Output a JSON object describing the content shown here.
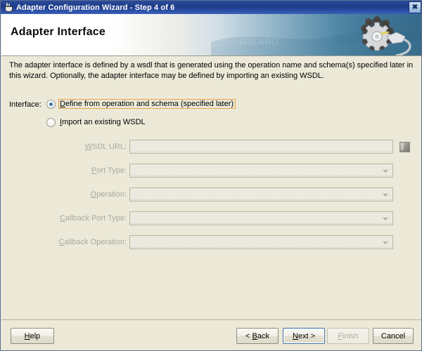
{
  "window": {
    "title": "Adapter Configuration Wizard - Step 4 of 6",
    "app_icon": "java-coffee-cup-icon",
    "close_label": "✕"
  },
  "header": {
    "title": "Adapter Interface",
    "banner_icon": "gear-and-cable-icon",
    "accent_color": "#376a8a"
  },
  "body": {
    "description": "The adapter interface is defined by a wsdl that is generated using the operation name and schema(s) specified later in this wizard.  Optionally, the adapter interface may be defined by importing an existing WSDL.",
    "interface_label": "Interface:",
    "options": [
      {
        "mnemonic": "D",
        "rest": "efine from operation and schema (specified later)",
        "selected": true,
        "focused": true
      },
      {
        "mnemonic": "I",
        "rest": "mport an existing WSDL",
        "selected": false,
        "focused": false
      }
    ],
    "fields": [
      {
        "mnemonic": "W",
        "rest": "SDL URL:",
        "type": "text",
        "value": "",
        "enabled": false,
        "has_browse": true
      },
      {
        "mnemonic": "P",
        "rest": "ort Type:",
        "type": "select",
        "value": "",
        "enabled": false,
        "has_browse": false
      },
      {
        "mnemonic": "O",
        "rest": "peration:",
        "type": "select",
        "value": "",
        "enabled": false,
        "has_browse": false
      },
      {
        "mnemonic": "C",
        "rest": "allback Port Type:",
        "type": "select",
        "value": "",
        "enabled": false,
        "has_browse": false
      },
      {
        "mnemonic": "C",
        "rest": "allback Operation:",
        "type": "select",
        "value": "",
        "enabled": false,
        "has_browse": false
      }
    ],
    "browse_icon": "folder-browse-icon"
  },
  "footer": {
    "buttons": [
      {
        "id": "help",
        "mnemonic": "H",
        "rest": "elp",
        "prefix": "",
        "suffix": "",
        "enabled": true,
        "default": false
      },
      {
        "id": "back",
        "mnemonic": "B",
        "rest": "ack",
        "prefix": "< ",
        "suffix": "",
        "enabled": true,
        "default": false
      },
      {
        "id": "next",
        "mnemonic": "N",
        "rest": "ext",
        "prefix": "",
        "suffix": " >",
        "enabled": true,
        "default": true
      },
      {
        "id": "finish",
        "mnemonic": "F",
        "rest": "inish",
        "prefix": "",
        "suffix": "",
        "enabled": false,
        "default": false
      },
      {
        "id": "cancel",
        "mnemonic": "",
        "rest": "Cancel",
        "prefix": "",
        "suffix": "",
        "enabled": true,
        "default": false
      }
    ]
  }
}
